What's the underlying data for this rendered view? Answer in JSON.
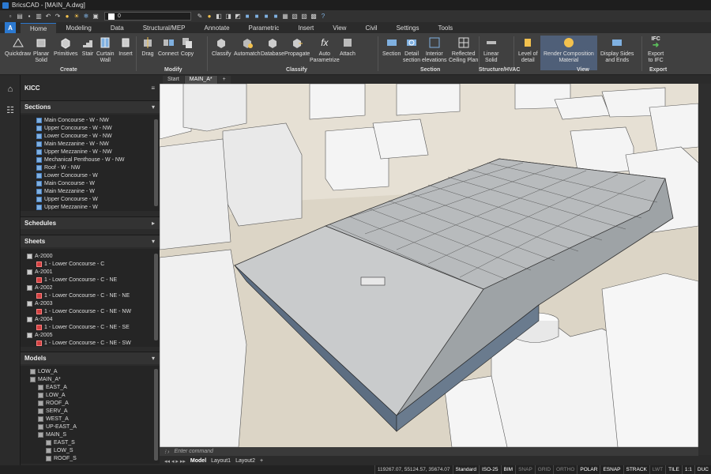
{
  "window": {
    "title": "BricsCAD - [MAIN_A.dwg]"
  },
  "qat": {
    "layer": "0"
  },
  "tabs": [
    "Home",
    "Modeling",
    "Data",
    "Structural/MEP",
    "Annotate",
    "Parametric",
    "Insert",
    "View",
    "Civil",
    "Settings",
    "Tools"
  ],
  "ribbon": {
    "buttons": [
      "Quickdraw",
      "Planar\nSolid",
      "Primitives",
      "Stair",
      "Curtain\nWall",
      "Insert",
      "Drag",
      "Connect",
      "Copy",
      "Classify",
      "Automatch",
      "Database",
      "Propagate",
      "Auto\nParametrize",
      "Attach",
      "Section",
      "Detail\nsection",
      "Interior\nelevations",
      "Reflected\nCeiling Plan",
      "Linear\nSolid",
      "Level of\ndetail",
      "Render Composition\nMaterial",
      "Display Sides\nand Ends",
      "Export\nto IFC"
    ],
    "groups": [
      "Create",
      "Modify",
      "Classify",
      "Section",
      "Structure/HVAC",
      "View",
      "Export"
    ],
    "ifc_label": "IFC"
  },
  "panel": {
    "project": "KICC",
    "sections_title": "Sections",
    "sections": [
      "Main Concourse - W - NW",
      "Upper Concourse - W - NW",
      "Lower Concourse - W - NW",
      "Main Mezzanine - W - NW",
      "Upper Mezzanine - W - NW",
      "Mechanical Penthouse - W - NW",
      "Roof - W - NW",
      "Lower Concourse - W",
      "Main Concourse - W",
      "Main Mezzanine - W",
      "Upper Concourse - W",
      "Upper Mezzanine - W"
    ],
    "schedules_title": "Schedules",
    "sheets_title": "Sheets",
    "sheets": [
      {
        "id": "A-2000",
        "view": "1 - Lower Concourse - C"
      },
      {
        "id": "A-2001",
        "view": "1 - Lower Concourse - C - NE"
      },
      {
        "id": "A-2002",
        "view": "1 - Lower Concourse - C - NE - NE"
      },
      {
        "id": "A-2003",
        "view": "1 - Lower Concourse - C - NE - NW"
      },
      {
        "id": "A-2004",
        "view": "1 - Lower Concourse - C - NE - SE"
      },
      {
        "id": "A-2005",
        "view": "1 - Lower Concourse - C - NE - SW"
      }
    ],
    "models_title": "Models",
    "models": [
      "LOW_A",
      "MAIN_A*",
      "EAST_A",
      "LOW_A",
      "ROOF_A",
      "SERV_A",
      "WEST_A",
      "UP-EAST_A",
      "MAIN_S",
      "EAST_S",
      "LOW_S",
      "ROOF_S"
    ]
  },
  "doctabs": [
    "Start",
    "MAIN_A*",
    "+"
  ],
  "command": {
    "placeholder": "Enter command"
  },
  "layouts": [
    "Model",
    "Layout1",
    "Layout2",
    "+"
  ],
  "status": {
    "coords": "119267.07, 55124.57, 35674.07",
    "items": [
      "Standard",
      "ISO-25",
      "BIM",
      "SNAP",
      "GRID",
      "ORTHO",
      "POLAR",
      "ESNAP",
      "STRACK",
      "LWT",
      "TILE",
      "1:1",
      "DUC"
    ]
  }
}
